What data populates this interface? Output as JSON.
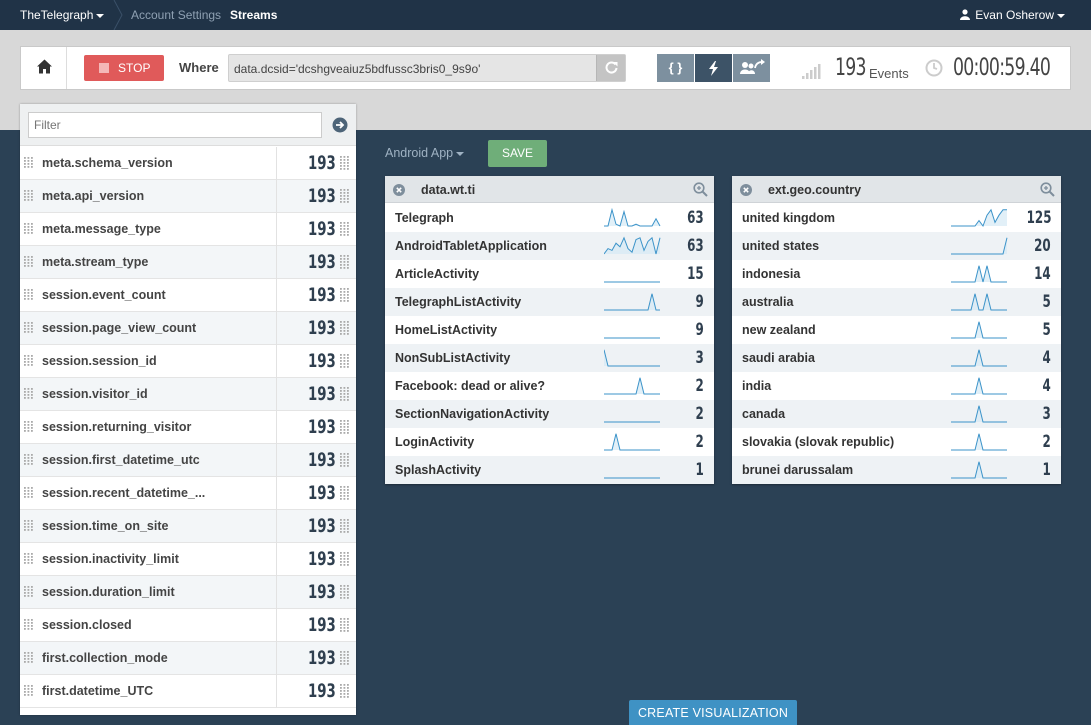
{
  "topnav": {
    "brand": "TheTelegraph",
    "breadcrumb": [
      "Account Settings",
      "Streams"
    ],
    "user": "Evan Osherow"
  },
  "controls": {
    "stop_label": "STOP",
    "where_label": "Where",
    "query": "data.dcsid='dcshgveaiuz5bdfussc3bris0_9s9o'",
    "buttons": [
      {
        "label": "{ }",
        "icon": "braces-icon"
      },
      {
        "label": "",
        "icon": "lightning-icon"
      },
      {
        "label": "",
        "icon": "users-share-icon"
      }
    ],
    "event_count": "193",
    "event_label": "Events",
    "timer": "00:00:59.40"
  },
  "fields": {
    "filter_placeholder": "Filter",
    "items": [
      {
        "name": "meta.schema_version",
        "count": "193"
      },
      {
        "name": "meta.api_version",
        "count": "193"
      },
      {
        "name": "meta.message_type",
        "count": "193"
      },
      {
        "name": "meta.stream_type",
        "count": "193"
      },
      {
        "name": "session.event_count",
        "count": "193"
      },
      {
        "name": "session.page_view_count",
        "count": "193"
      },
      {
        "name": "session.session_id",
        "count": "193"
      },
      {
        "name": "session.visitor_id",
        "count": "193"
      },
      {
        "name": "session.returning_visitor",
        "count": "193"
      },
      {
        "name": "session.first_datetime_utc",
        "count": "193"
      },
      {
        "name": "session.recent_datetime_...",
        "count": "193"
      },
      {
        "name": "session.time_on_site",
        "count": "193"
      },
      {
        "name": "session.inactivity_limit",
        "count": "193"
      },
      {
        "name": "session.duration_limit",
        "count": "193"
      },
      {
        "name": "session.closed",
        "count": "193"
      },
      {
        "name": "first.collection_mode",
        "count": "193"
      },
      {
        "name": "first.datetime_UTC",
        "count": "193"
      }
    ]
  },
  "toolbar": {
    "app_select": "Android App",
    "save_label": "SAVE"
  },
  "panels": [
    {
      "title": "data.wt.ti",
      "rows": [
        {
          "label": "Telegraph",
          "count": "63",
          "spark": [
            0,
            0,
            9,
            1,
            0,
            8,
            0,
            0,
            1,
            0,
            0,
            0,
            0,
            4,
            0
          ]
        },
        {
          "label": "AndroidTabletApplication",
          "count": "63",
          "spark": [
            0,
            3,
            2,
            6,
            4,
            9,
            3,
            1,
            8,
            9,
            2,
            7,
            9,
            0,
            9
          ]
        },
        {
          "label": "ArticleActivity",
          "count": "15",
          "spark": [
            0,
            0,
            0,
            0,
            0,
            0,
            0,
            0,
            0,
            0,
            0,
            0,
            0,
            0,
            0
          ]
        },
        {
          "label": "TelegraphListActivity",
          "count": "9",
          "spark": [
            0,
            0,
            0,
            0,
            0,
            0,
            0,
            0,
            0,
            0,
            0,
            0,
            9,
            0,
            0
          ]
        },
        {
          "label": "HomeListActivity",
          "count": "9",
          "spark": [
            0,
            0,
            0,
            0,
            0,
            0,
            0,
            0,
            0,
            0,
            0,
            0,
            0,
            0,
            0
          ]
        },
        {
          "label": "NonSubListActivity",
          "count": "3",
          "spark": [
            9,
            0,
            0,
            0,
            0,
            0,
            0,
            0,
            0,
            0,
            0,
            0,
            0,
            0,
            0
          ]
        },
        {
          "label": "Facebook: dead or alive?",
          "count": "2",
          "spark": [
            0,
            0,
            0,
            0,
            0,
            0,
            0,
            0,
            0,
            9,
            0,
            0,
            0,
            0,
            0
          ]
        },
        {
          "label": "SectionNavigationActivity",
          "count": "2",
          "spark": [
            0,
            0,
            0,
            0,
            0,
            0,
            0,
            0,
            0,
            0,
            0,
            0,
            0,
            0,
            0
          ]
        },
        {
          "label": "LoginActivity",
          "count": "2",
          "spark": [
            0,
            0,
            0,
            9,
            0,
            0,
            0,
            0,
            0,
            0,
            0,
            0,
            0,
            0,
            0
          ]
        },
        {
          "label": "SplashActivity",
          "count": "1",
          "spark": [
            0,
            0,
            0,
            0,
            0,
            0,
            0,
            0,
            0,
            0,
            0,
            0,
            0,
            0,
            0
          ]
        }
      ]
    },
    {
      "title": "ext.geo.country",
      "rows": [
        {
          "label": "united kingdom",
          "count": "125",
          "spark": [
            0,
            0,
            0,
            0,
            0,
            0,
            0,
            3,
            0,
            6,
            9,
            2,
            6,
            9,
            9
          ]
        },
        {
          "label": "united states",
          "count": "20",
          "spark": [
            0,
            0,
            0,
            0,
            0,
            0,
            0,
            0,
            0,
            0,
            0,
            0,
            0,
            0,
            9
          ]
        },
        {
          "label": "indonesia",
          "count": "14",
          "spark": [
            0,
            0,
            0,
            0,
            0,
            0,
            0,
            9,
            0,
            9,
            0,
            0,
            0,
            0,
            0
          ]
        },
        {
          "label": "australia",
          "count": "5",
          "spark": [
            0,
            0,
            0,
            0,
            0,
            0,
            9,
            0,
            0,
            9,
            0,
            0,
            0,
            0,
            0
          ]
        },
        {
          "label": "new zealand",
          "count": "5",
          "spark": [
            0,
            0,
            0,
            0,
            0,
            0,
            0,
            9,
            0,
            0,
            0,
            0,
            0,
            0,
            0
          ]
        },
        {
          "label": "saudi arabia",
          "count": "4",
          "spark": [
            0,
            0,
            0,
            0,
            0,
            0,
            0,
            9,
            0,
            0,
            0,
            0,
            0,
            0,
            0
          ]
        },
        {
          "label": "india",
          "count": "4",
          "spark": [
            0,
            0,
            0,
            0,
            0,
            0,
            0,
            9,
            0,
            0,
            0,
            0,
            0,
            0,
            0
          ]
        },
        {
          "label": "canada",
          "count": "3",
          "spark": [
            0,
            0,
            0,
            0,
            0,
            0,
            0,
            9,
            0,
            0,
            0,
            0,
            0,
            0,
            0
          ]
        },
        {
          "label": "slovakia (slovak republic)",
          "count": "2",
          "spark": [
            0,
            0,
            0,
            0,
            0,
            0,
            0,
            9,
            0,
            0,
            0,
            0,
            0,
            0,
            0
          ]
        },
        {
          "label": "brunei darussalam",
          "count": "1",
          "spark": [
            0,
            0,
            0,
            0,
            0,
            0,
            0,
            9,
            0,
            0,
            0,
            0,
            0,
            0,
            0
          ]
        }
      ]
    }
  ],
  "create_label": "CREATE VISUALIZATION",
  "colors": {
    "stop": "#e05a5a",
    "save": "#6fae79",
    "create": "#3f92c4",
    "sparkline": "#3b93c9"
  }
}
